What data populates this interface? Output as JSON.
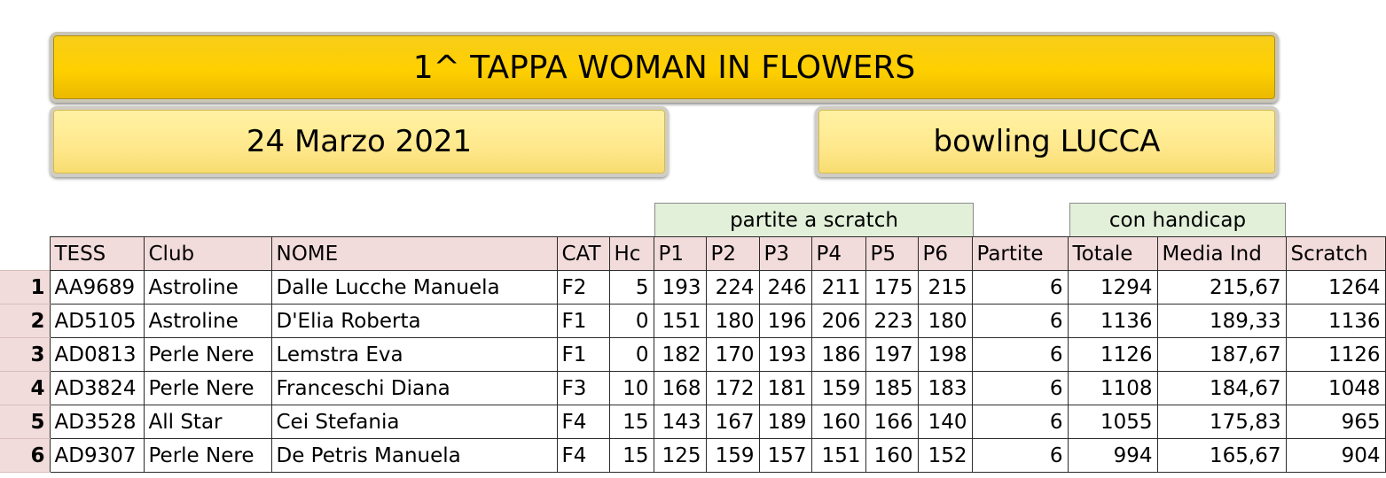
{
  "header": {
    "title": "1^ TAPPA WOMAN IN FLOWERS",
    "date": "24 Marzo 2021",
    "venue": "bowling LUCCA"
  },
  "groups": {
    "scratch": "partite a scratch",
    "handicap": "con handicap"
  },
  "columns": [
    "TESS",
    "Club",
    "NOME",
    "CAT",
    "Hc",
    "P1",
    "P2",
    "P3",
    "P4",
    "P5",
    "P6",
    "Partite",
    "Totale",
    "Media Ind",
    "Scratch"
  ],
  "rows": [
    [
      "1",
      "AA9689",
      "Astroline",
      "Dalle Lucche Manuela",
      "F2",
      "5",
      "193",
      "224",
      "246",
      "211",
      "175",
      "215",
      "6",
      "1294",
      "215,67",
      "1264"
    ],
    [
      "2",
      "AD5105",
      "Astroline",
      "D'Elia Roberta",
      "F1",
      "0",
      "151",
      "180",
      "196",
      "206",
      "223",
      "180",
      "6",
      "1136",
      "189,33",
      "1136"
    ],
    [
      "3",
      "AD0813",
      "Perle Nere",
      "Lemstra Eva",
      "F1",
      "0",
      "182",
      "170",
      "193",
      "186",
      "197",
      "198",
      "6",
      "1126",
      "187,67",
      "1126"
    ],
    [
      "4",
      "AD3824",
      "Perle Nere",
      "Franceschi Diana",
      "F3",
      "10",
      "168",
      "172",
      "181",
      "159",
      "185",
      "183",
      "6",
      "1108",
      "184,67",
      "1048"
    ],
    [
      "5",
      "AD3528",
      "All Star",
      "Cei Stefania",
      "F4",
      "15",
      "143",
      "167",
      "189",
      "160",
      "166",
      "140",
      "6",
      "1055",
      "175,83",
      "965"
    ],
    [
      "6",
      "AD9307",
      "Perle Nere",
      "De Petris Manuela",
      "F4",
      "15",
      "125",
      "159",
      "157",
      "151",
      "160",
      "152",
      "6",
      "994",
      "165,67",
      "904"
    ]
  ]
}
